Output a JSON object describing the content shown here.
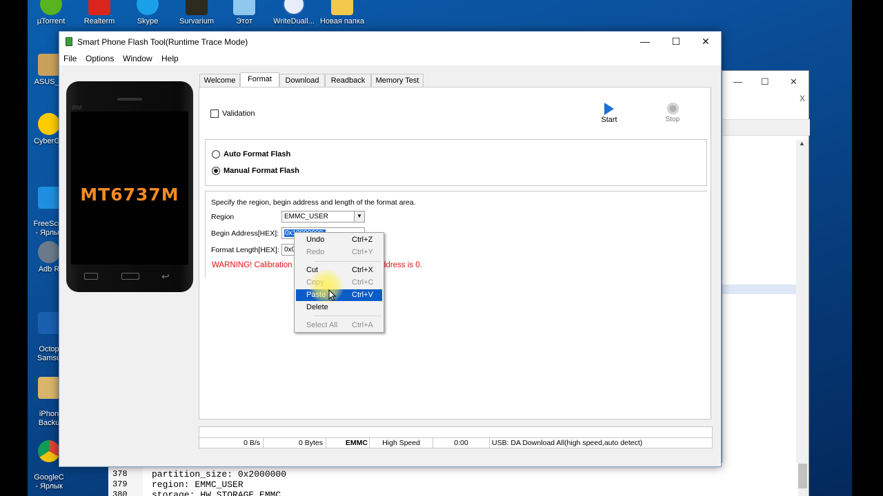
{
  "desktop": {
    "top_icons": [
      "µTorrent",
      "Realterm",
      "Skype",
      "Survarium",
      "Этот",
      "WriteDuall...",
      "Новая папка"
    ],
    "left_icons": [
      {
        "label": "ASUS_F"
      },
      {
        "label": "CyberGh"
      },
      {
        "label": "FreeScre\n- Ярлык"
      },
      {
        "label": "Adb R"
      },
      {
        "label": "Octop\nSamsu"
      },
      {
        "label": "iPhon\nBacku"
      },
      {
        "label": "GoogleC\n- Ярлык"
      }
    ]
  },
  "editor": {
    "lines": [
      {
        "num": "378",
        "text": "partition_size: 0x2000000"
      },
      {
        "num": "379",
        "text": "region: EMMC_USER"
      },
      {
        "num": "380",
        "text": "storage: HW_STORAGE_EMMC"
      }
    ]
  },
  "bg_window": {
    "close_small": "X"
  },
  "window": {
    "title": "Smart Phone Flash Tool(Runtime Trace Mode)",
    "controls": {
      "minimize": "—",
      "maximize": "☐",
      "close": "✕"
    },
    "menu": [
      "File",
      "Options",
      "Window",
      "Help"
    ]
  },
  "phone": {
    "chip_label": "MT6737M",
    "small_text": "IRM"
  },
  "tabs": [
    {
      "label": "Welcome",
      "active": false
    },
    {
      "label": "Format",
      "active": true
    },
    {
      "label": "Download",
      "active": false
    },
    {
      "label": "Readback",
      "active": false
    },
    {
      "label": "Memory Test",
      "active": false
    }
  ],
  "format": {
    "validation_label": "Validation",
    "validation_checked": false,
    "start_label": "Start",
    "stop_label": "Stop",
    "auto_label": "Auto Format Flash",
    "manual_label": "Manual Format Flash",
    "selected_mode": "manual",
    "instructions": "Specify the region, begin address and length of the format area.",
    "region_label": "Region",
    "region_value": "EMMC_USER",
    "begin_label": "Begin Address[HEX]:",
    "begin_value": "0x10000000",
    "length_label": "Format Length[HEX]:",
    "length_value": "0x0",
    "warning_start": "WARNING! Calibration",
    "warning_end": "ddress is 0.",
    "accent_color": "#1b6fd4",
    "warning_color": "#e01010"
  },
  "status": {
    "speed": "0 B/s",
    "bytes": "0 Bytes",
    "storage": "EMMC",
    "mode": "High Speed",
    "time": "0:00",
    "connection": "USB: DA Download All(high speed,auto detect)"
  },
  "context_menu": {
    "items": [
      {
        "label": "Undo",
        "shortcut": "Ctrl+Z",
        "enabled": true
      },
      {
        "label": "Redo",
        "shortcut": "Ctrl+Y",
        "enabled": false
      },
      {
        "label": "Cut",
        "shortcut": "Ctrl+X",
        "enabled": true
      },
      {
        "label": "Copy",
        "shortcut": "Ctrl+C",
        "enabled": false
      },
      {
        "label": "Paste",
        "shortcut": "Ctrl+V",
        "enabled": true,
        "highlighted": true
      },
      {
        "label": "Delete",
        "shortcut": "",
        "enabled": true
      },
      {
        "label": "Select All",
        "shortcut": "Ctrl+A",
        "enabled": false
      }
    ]
  }
}
